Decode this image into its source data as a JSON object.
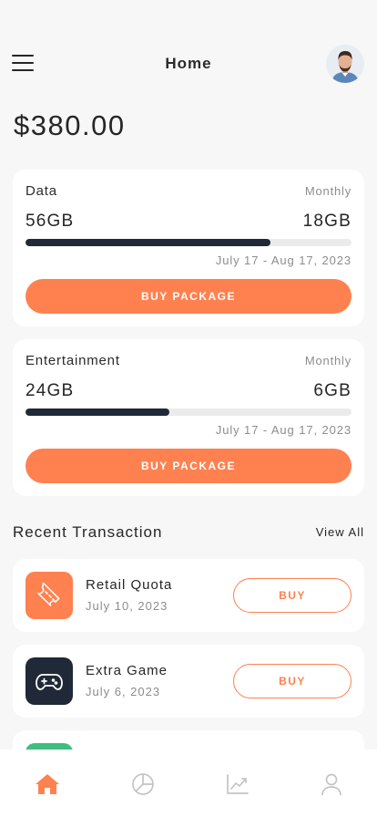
{
  "header": {
    "title": "Home"
  },
  "balance": "$380.00",
  "packages": [
    {
      "label": "Data",
      "period": "Monthly",
      "total": "56GB",
      "remaining": "18GB",
      "progress_fraction": 0.75,
      "date_range": "July 17 - Aug 17, 2023",
      "button_label": "BUY PACKAGE"
    },
    {
      "label": "Entertainment",
      "period": "Monthly",
      "total": "24GB",
      "remaining": "6GB",
      "progress_fraction": 0.44,
      "date_range": "July 17 - Aug 17, 2023",
      "button_label": "BUY PACKAGE"
    }
  ],
  "recent": {
    "title": "Recent Transaction",
    "view_all": "View All",
    "items": [
      {
        "name": "Retail Quota",
        "date": "July 10, 2023",
        "button_label": "BUY",
        "icon": "ticket-icon",
        "icon_color": "#ff8150"
      },
      {
        "name": "Extra Game",
        "date": "July 6, 2023",
        "button_label": "BUY",
        "icon": "gamepad-icon",
        "icon_color": "#1f2937"
      }
    ],
    "partial_item_icon_color": "#3fbf7f"
  },
  "nav": {
    "items": [
      "home-icon",
      "pie-chart-icon",
      "trend-chart-icon",
      "profile-icon"
    ],
    "active": "home-icon",
    "active_color": "#ff8150",
    "inactive_color": "#c4c4c4"
  },
  "colors": {
    "accent": "#ff8150",
    "progress": "#1f2937",
    "background": "#f7f7f7"
  }
}
